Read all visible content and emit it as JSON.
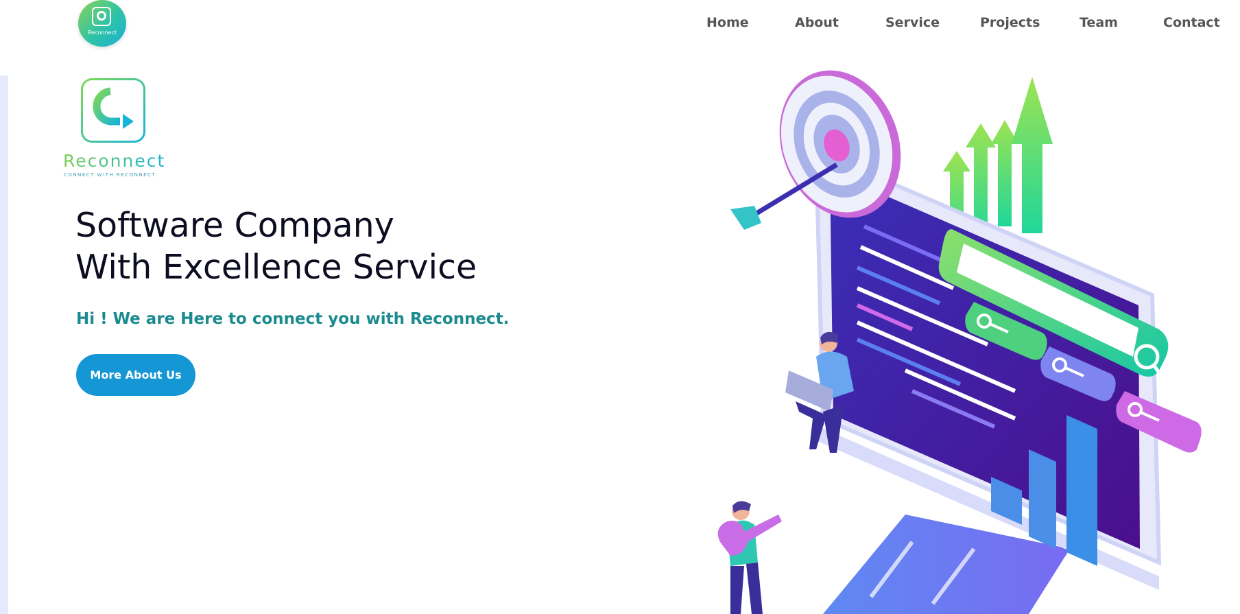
{
  "nav": {
    "logo_text": "Reconnect",
    "items": [
      "Home",
      "About",
      "Service",
      "Projects",
      "Team",
      "Contact"
    ]
  },
  "brand": {
    "name": "Reconnect",
    "tagline": "CONNECT WITH RECONNECT"
  },
  "hero": {
    "title_line1": "Software Company",
    "title_line2": "With Excellence Service",
    "subtitle": "Hi ! We are Here to connect you with Reconnect.",
    "cta_label": "More About Us"
  },
  "colors": {
    "accent": "#1497d4",
    "subtitle": "#1b8a8e",
    "brand_green": "#7ed957",
    "brand_blue": "#17b3d8"
  }
}
